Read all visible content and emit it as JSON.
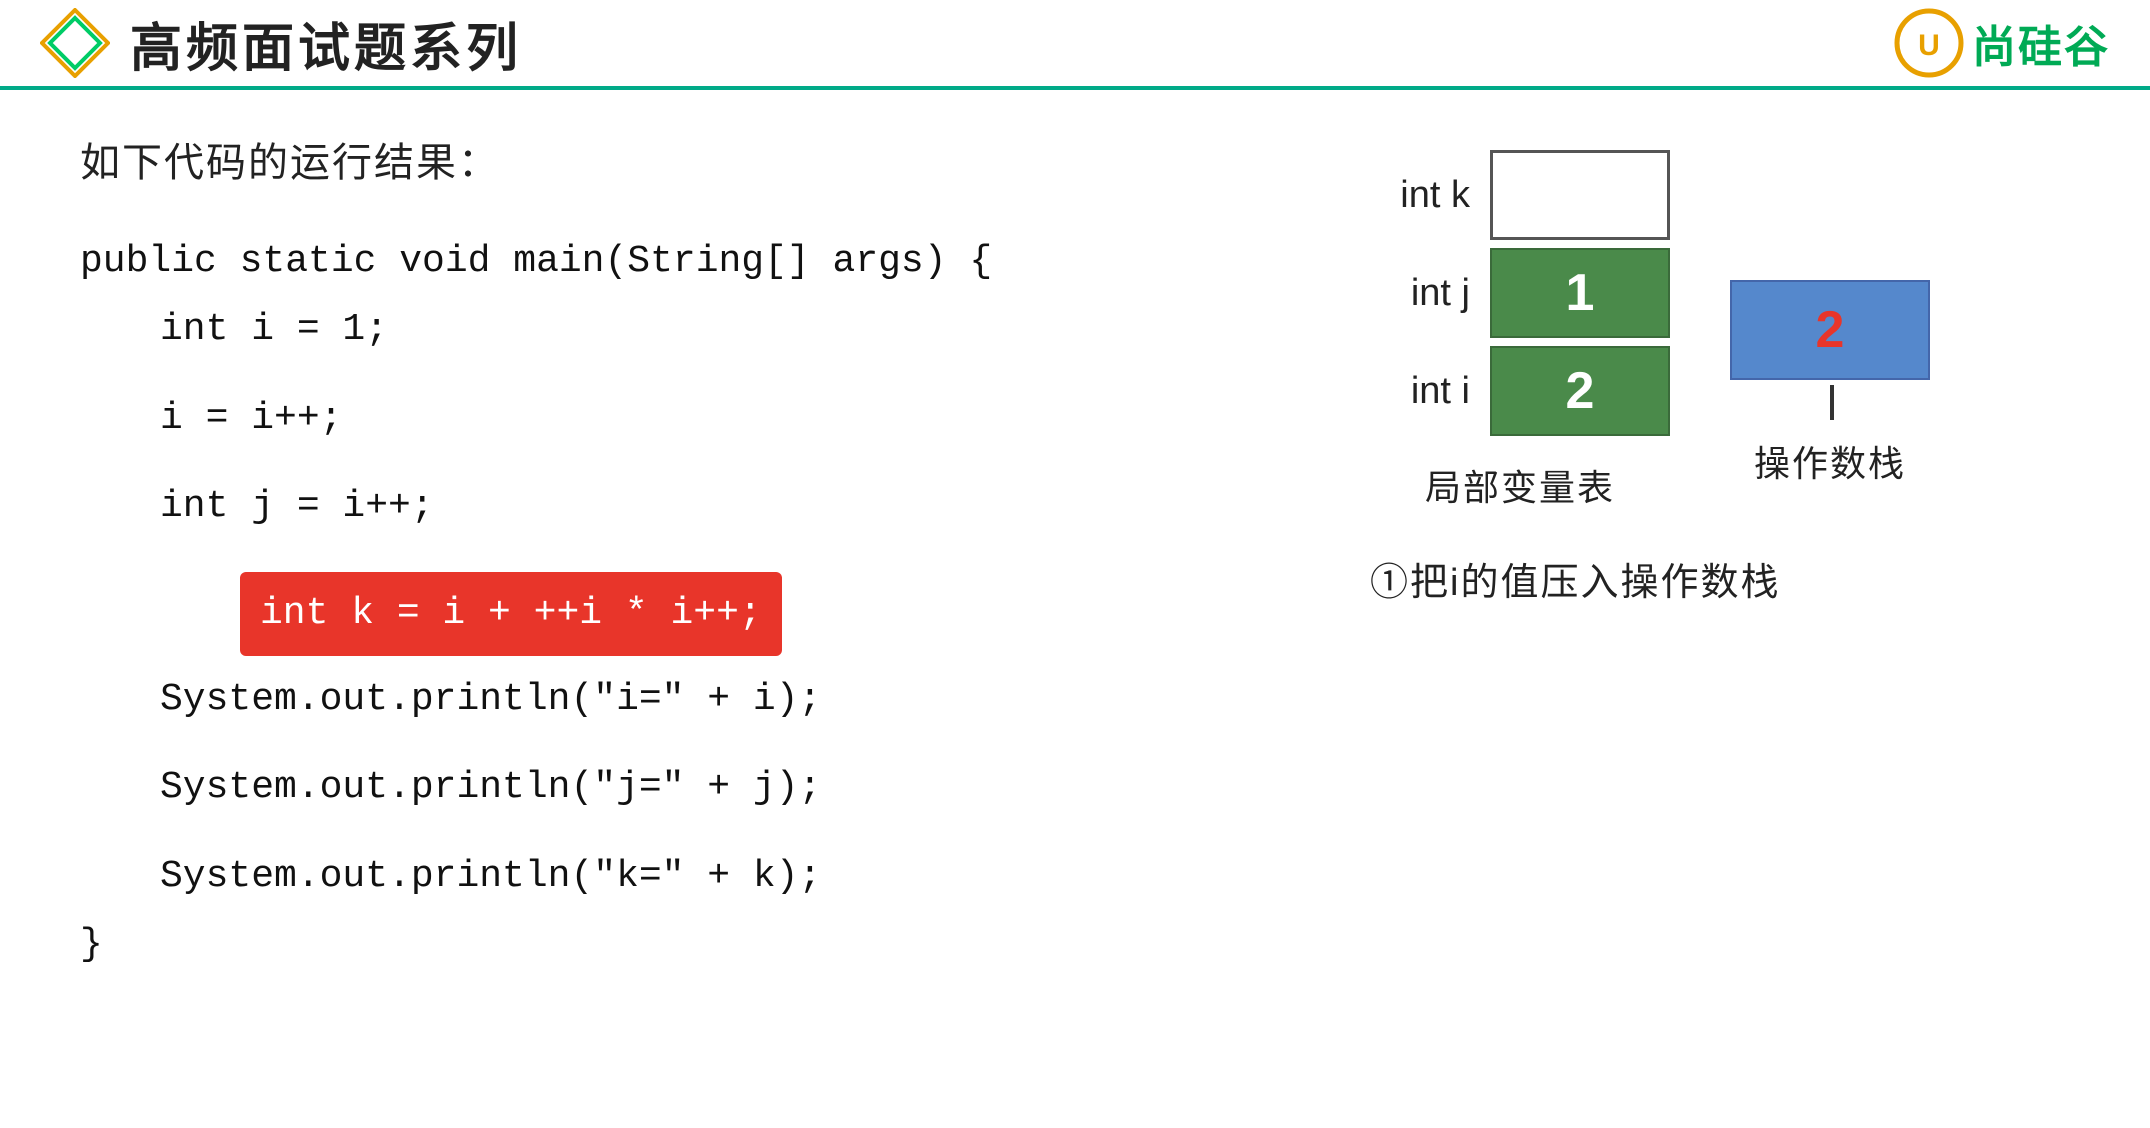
{
  "header": {
    "title": "高频面试题系列",
    "brand_text": "尚硅谷"
  },
  "question": {
    "description": "如下代码的运行结果：",
    "code_lines": [
      {
        "id": "line-class",
        "text": "public static void main(String[] args) {",
        "indent": 0
      },
      {
        "id": "line-i-decl",
        "text": "int i = 1;",
        "indent": 1
      },
      {
        "id": "line-empty1",
        "text": "",
        "indent": 0
      },
      {
        "id": "line-i-assign",
        "text": "i = i++;",
        "indent": 1
      },
      {
        "id": "line-empty2",
        "text": "",
        "indent": 0
      },
      {
        "id": "line-j-decl",
        "text": "int j = i++;",
        "indent": 1
      },
      {
        "id": "line-empty3",
        "text": "",
        "indent": 0
      },
      {
        "id": "line-k-decl",
        "text": "int k = i + ++i * i++;",
        "indent": 1,
        "highlighted": true
      },
      {
        "id": "line-print-i",
        "text": "System.out.println(\"i=\" + i);",
        "indent": 1
      },
      {
        "id": "line-empty4",
        "text": "",
        "indent": 0
      },
      {
        "id": "line-print-j",
        "text": "System.out.println(\"j=\" + j);",
        "indent": 1
      },
      {
        "id": "line-empty5",
        "text": "",
        "indent": 0
      },
      {
        "id": "line-print-k",
        "text": "System.out.println(\"k=\" + k);",
        "indent": 1
      },
      {
        "id": "line-close",
        "text": "}",
        "indent": 0
      }
    ]
  },
  "diagram": {
    "vars": [
      {
        "name": "int  k",
        "value": "",
        "empty": true
      },
      {
        "name": "int  j",
        "value": "1",
        "color": "green"
      },
      {
        "name": "int  i",
        "value": "2",
        "color": "green"
      }
    ],
    "local_vars_label": "局部变量表",
    "operand_stack_label": "操作数栈",
    "stack_value": "2",
    "explanation": "①把i的值压入操作数栈"
  }
}
